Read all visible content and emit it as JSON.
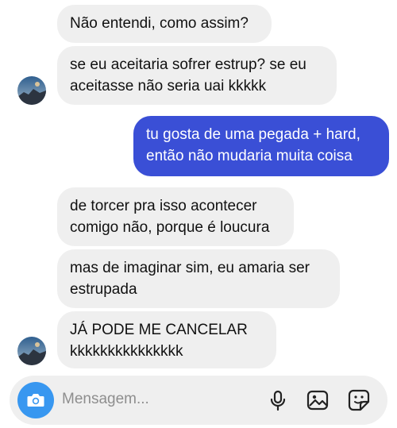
{
  "messages": [
    {
      "side": "in",
      "text": "Não entendi, como assim?"
    },
    {
      "side": "in",
      "text": "se eu aceitaria sofrer estrup? se eu\naceitasse não seria uai kkkkk"
    },
    {
      "side": "out",
      "text": "tu gosta de uma pegada + hard,\nentão não mudaria muita coisa"
    },
    {
      "side": "in",
      "text": "de torcer pra isso acontecer\ncomigo não, porque é loucura"
    },
    {
      "side": "in",
      "text": "mas de imaginar sim, eu amaria ser\nestrupada"
    },
    {
      "side": "in",
      "text": "JÁ PODE ME CANCELAR\nkkkkkkkkkkkkkkk"
    }
  ],
  "composer": {
    "placeholder": "Mensagem...",
    "icons": [
      "camera-icon",
      "microphone-icon",
      "gallery-icon",
      "sticker-icon"
    ]
  },
  "colors": {
    "incoming_bubble": "#efefef",
    "outgoing_bubble": "#3a4fd6",
    "camera_button": "#3897f0"
  }
}
